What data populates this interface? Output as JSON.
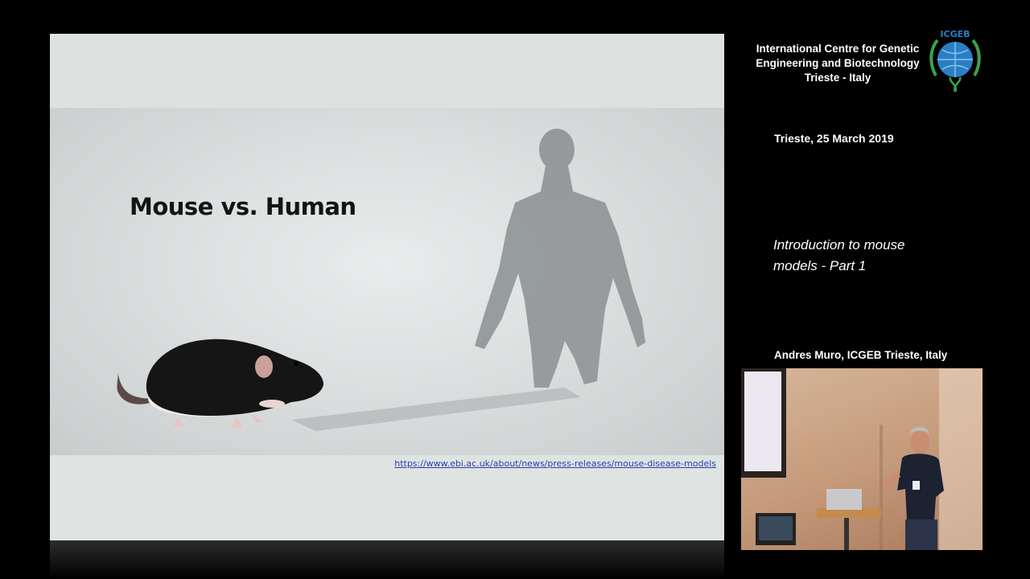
{
  "slide": {
    "title": "Mouse vs. Human",
    "link": "https://www.ebi.ac.uk/about/news/press-releases/mouse-disease-models"
  },
  "sidebar": {
    "org_lines": [
      "International Centre for Genetic",
      "Engineering and Biotechnology",
      "Trieste - Italy"
    ],
    "logo_text": "ICGEB",
    "date": "Trieste, 25 March 2019",
    "talk_title_lines": [
      "Introduction to mouse",
      "models - Part 1"
    ],
    "speaker": "Andres Muro, ICGEB Trieste, Italy"
  },
  "colors": {
    "background": "#000000",
    "slide_background": "#dfe3e2",
    "link": "#2a3fb0",
    "logo_blue": "#2a7fc4",
    "logo_green": "#3aa24a"
  },
  "icons": {
    "logo": "icgeb-globe-logo"
  }
}
